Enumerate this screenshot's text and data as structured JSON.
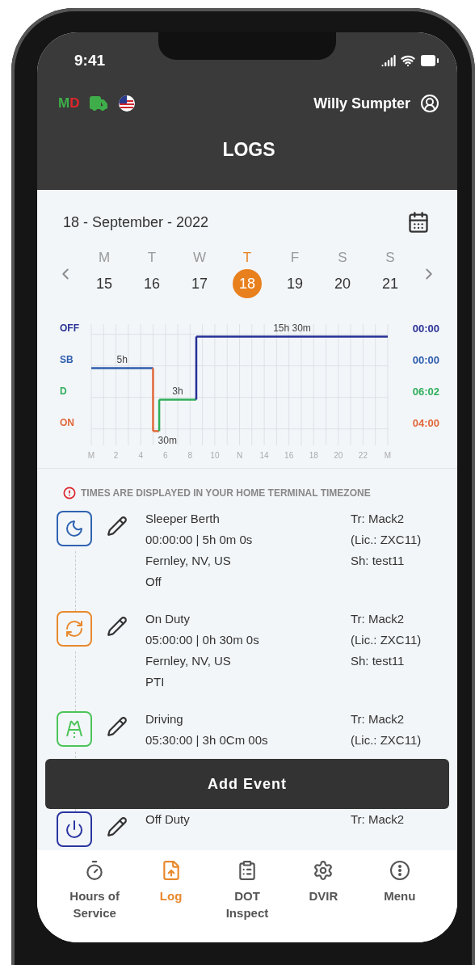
{
  "status_bar": {
    "time": "9:41"
  },
  "header": {
    "status_letters": [
      {
        "text": "M",
        "color": "#3fae4a"
      },
      {
        "text": "D",
        "color": "#e0262a"
      }
    ],
    "driver": "Willy Sumpter",
    "title": "LOGS"
  },
  "date": {
    "label": "18 - September - 2022"
  },
  "week": [
    {
      "letter": "M",
      "day": "15",
      "selected": false
    },
    {
      "letter": "T",
      "day": "16",
      "selected": false
    },
    {
      "letter": "W",
      "day": "17",
      "selected": false
    },
    {
      "letter": "T",
      "day": "18",
      "selected": true
    },
    {
      "letter": "F",
      "day": "19",
      "selected": false
    },
    {
      "letter": "S",
      "day": "20",
      "selected": false
    },
    {
      "letter": "S",
      "day": "21",
      "selected": false
    }
  ],
  "chart": {
    "hour_labels": [
      "M",
      "2",
      "4",
      "6",
      "8",
      "10",
      "N",
      "14",
      "16",
      "18",
      "20",
      "22",
      "M"
    ],
    "durations": [
      "5h",
      "30m",
      "3h",
      "15h 30m"
    ],
    "statuses": [
      {
        "label": "OFF",
        "total": "00:00",
        "color": "#2a3296"
      },
      {
        "label": "SB",
        "total": "00:00",
        "color": "#2f5eae"
      },
      {
        "label": "D",
        "total": "06:02",
        "color": "#2fae5a"
      },
      {
        "label": "ON",
        "total": "04:00",
        "color": "#e0683a"
      }
    ]
  },
  "notice": "TIMES ARE DISPLAYED IN YOUR HOME TERMINAL TIMEZONE",
  "events": [
    {
      "kind": "sleeper",
      "title": "Sleeper Berth",
      "lines": [
        "00:00:00 | 5h 0m 0s",
        "Fernley, NV, US",
        "Off"
      ],
      "details": [
        "Tr: Mack2",
        "(Lic.: ZXC11)",
        "Sh: test11"
      ]
    },
    {
      "kind": "on_duty",
      "title": "On Duty",
      "lines": [
        "05:00:00 | 0h 30m 0s",
        "Fernley, NV, US",
        "PTI"
      ],
      "details": [
        "Tr: Mack2",
        "(Lic.: ZXC11)",
        "Sh: test11"
      ]
    },
    {
      "kind": "driving",
      "title": "Driving",
      "lines": [
        "05:30:00 | 3h 0Cm 00s"
      ],
      "details": [
        "Tr: Mack2",
        "(Lic.: ZXC11)"
      ]
    },
    {
      "kind": "off_duty",
      "title": "Off Duty",
      "details": [
        "Tr: Mack2"
      ]
    }
  ],
  "add_button": "Add Event",
  "nav": [
    {
      "label": "Hours of Service",
      "selected": false
    },
    {
      "label": "Log",
      "selected": true
    },
    {
      "label": "DOT Inspect",
      "selected": false
    },
    {
      "label": "DVIR",
      "selected": false
    },
    {
      "label": "Menu",
      "selected": false
    }
  ]
}
